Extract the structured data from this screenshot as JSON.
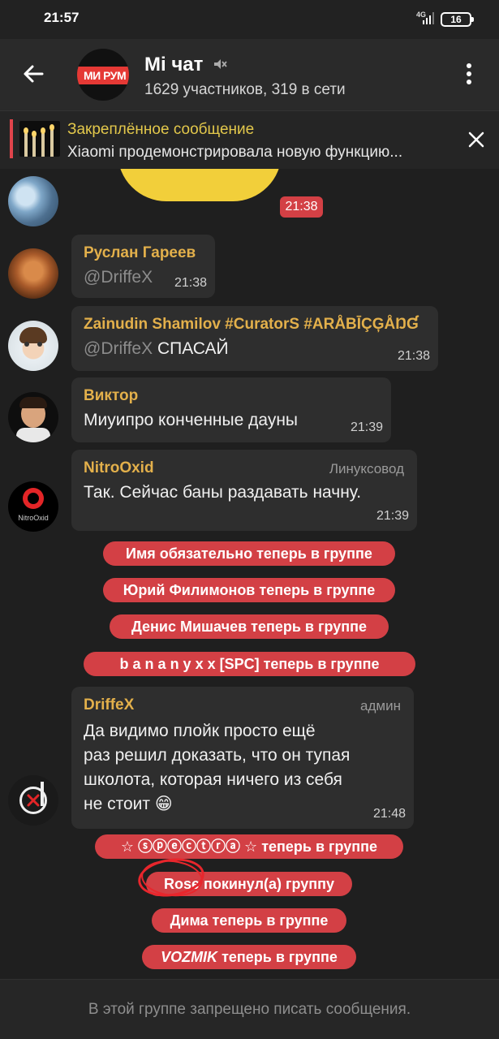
{
  "status_bar": {
    "time": "21:57",
    "network": "4G",
    "battery": "16"
  },
  "header": {
    "avatar_label": "МИ РУМ",
    "title": "Mi чат",
    "subtitle": "1629 участников, 319 в сети"
  },
  "pinned": {
    "title": "Закреплённое сообщение",
    "text": "Xiaomi продемонстрировала новую функцию..."
  },
  "sticker_time": "21:38",
  "messages": [
    {
      "name": "Руслан Гареев",
      "role": "",
      "mention": "@DriffeX",
      "text": "",
      "time": "21:38"
    },
    {
      "name": "Zainudin Shamilov #CuratorS #ARÅBĪÇĢÅŊƓ",
      "role": "",
      "mention": "@DriffeX",
      "text": " СПАСАЙ",
      "time": "21:38"
    },
    {
      "name": "Виктор",
      "role": "",
      "mention": "",
      "text": "Миуипро конченные дауны",
      "time": "21:39"
    },
    {
      "name": "NitroOxid",
      "role": "Линуксовод",
      "mention": "",
      "text": "Так. Сейчас баны раздавать начну.",
      "time": "21:39",
      "avatar_label": "NitroOxid"
    },
    {
      "name": "DriffeX",
      "role": "админ",
      "mention": "",
      "lines": [
        "Да видимо плойк просто ещё",
        "раз решил доказать, что он тупая",
        "школота, которая ничего из себя",
        "не стоит 😁"
      ],
      "time": "21:48"
    }
  ],
  "service_messages": [
    "Имя обязательно теперь в группе",
    "Юрий Филимонов теперь в группе",
    "Денис Мишачев теперь в группе",
    "b a n a n y x x [SPC] теперь в группе",
    "☆ ⓢⓟⓔⓒⓣⓡⓐ ☆ теперь в группе",
    "Rose покинул(а) группу",
    "Дима теперь в группе",
    "теперь в группе"
  ],
  "vozmik_name": "VOZMIK",
  "footer": {
    "text": "В этой группе запрещено писать сообщения."
  },
  "colors": {
    "accent_red": "#d34045",
    "name_gold": "#e3b04b",
    "pinned_title": "#e3c84b",
    "bubble": "#2e2e2e",
    "background": "#1f1f1f"
  }
}
